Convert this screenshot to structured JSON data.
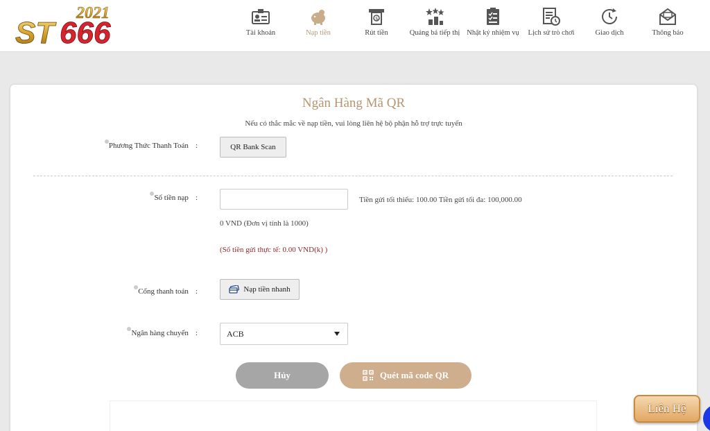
{
  "brand": {
    "logo_text": "ST666",
    "logo_year": "2021"
  },
  "nav": [
    {
      "label": "Tài khoản",
      "icon": "id-card-icon"
    },
    {
      "label": "Nạp tiền",
      "icon": "piggy-bank-icon",
      "active": true
    },
    {
      "label": "Rút tiền",
      "icon": "withdraw-icon"
    },
    {
      "label": "Quảng bá tiếp thị",
      "icon": "stars-chart-icon"
    },
    {
      "label": "Nhật ký nhiệm vụ",
      "icon": "checklist-icon"
    },
    {
      "label": "Lịch sử trò chơi",
      "icon": "history-doc-icon"
    },
    {
      "label": "Giao dịch",
      "icon": "clock-icon"
    },
    {
      "label": "Thông báo",
      "icon": "mail-icon"
    }
  ],
  "form": {
    "title": "Ngân Hàng Mã QR",
    "subtitle": "Nếu có thắc mắc về nạp tiền, vui lòng liên hệ bộ phận hỗ trợ trực tuyến",
    "payment_method_label": "Phương Thức Thanh Toán",
    "payment_method_value": "QR Bank Scan",
    "amount_label": "Số tiền nạp",
    "amount_value": "",
    "amount_limits": "Tiền gửi tối thiểu: 100.00 Tiền gửi tối đa: 100,000.00",
    "amount_unit_note": "0 VND (Đơn vị tính là 1000)",
    "actual_amount_note": "(Số tiền gửi thực tế: 0.00 VND(k) )",
    "gateway_label": "Cổng thanh toán",
    "gateway_value": "Nạp tiền nhanh",
    "bank_label": "Ngân hàng chuyển",
    "bank_selected": "ACB",
    "colon": ":",
    "cancel_label": "Hủy",
    "scan_qr_label": "Quét mã code QR"
  },
  "contact": {
    "label": "Liên Hệ"
  },
  "colors": {
    "accent": "#b59572",
    "qr_button": "#cfae8e",
    "cancel_button": "#a6a6a6",
    "chat_fab": "#1c37e4"
  }
}
